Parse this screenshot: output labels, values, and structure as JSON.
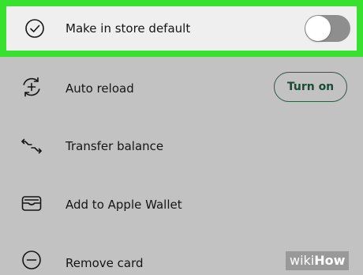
{
  "menu": {
    "default_row": {
      "label": "Make in store default",
      "icon": "checkmark-circle-icon",
      "toggle_on": false
    },
    "reload_row": {
      "label": "Auto reload",
      "icon": "reload-plus-icon",
      "button_label": "Turn on"
    },
    "transfer_row": {
      "label": "Transfer balance",
      "icon": "transfer-arrows-icon"
    },
    "wallet_row": {
      "label": "Add to Apple Wallet",
      "icon": "wallet-icon"
    },
    "remove_row": {
      "label": "Remove card",
      "icon": "minus-circle-icon"
    }
  },
  "watermark": {
    "wiki": "wiki",
    "how": "How"
  },
  "colors": {
    "highlight": "#37e12e",
    "background": "#c2c2c2",
    "highlighted_row": "#efefef",
    "toggle_off": "#8e8e8e",
    "button_text": "#1b4c35"
  }
}
